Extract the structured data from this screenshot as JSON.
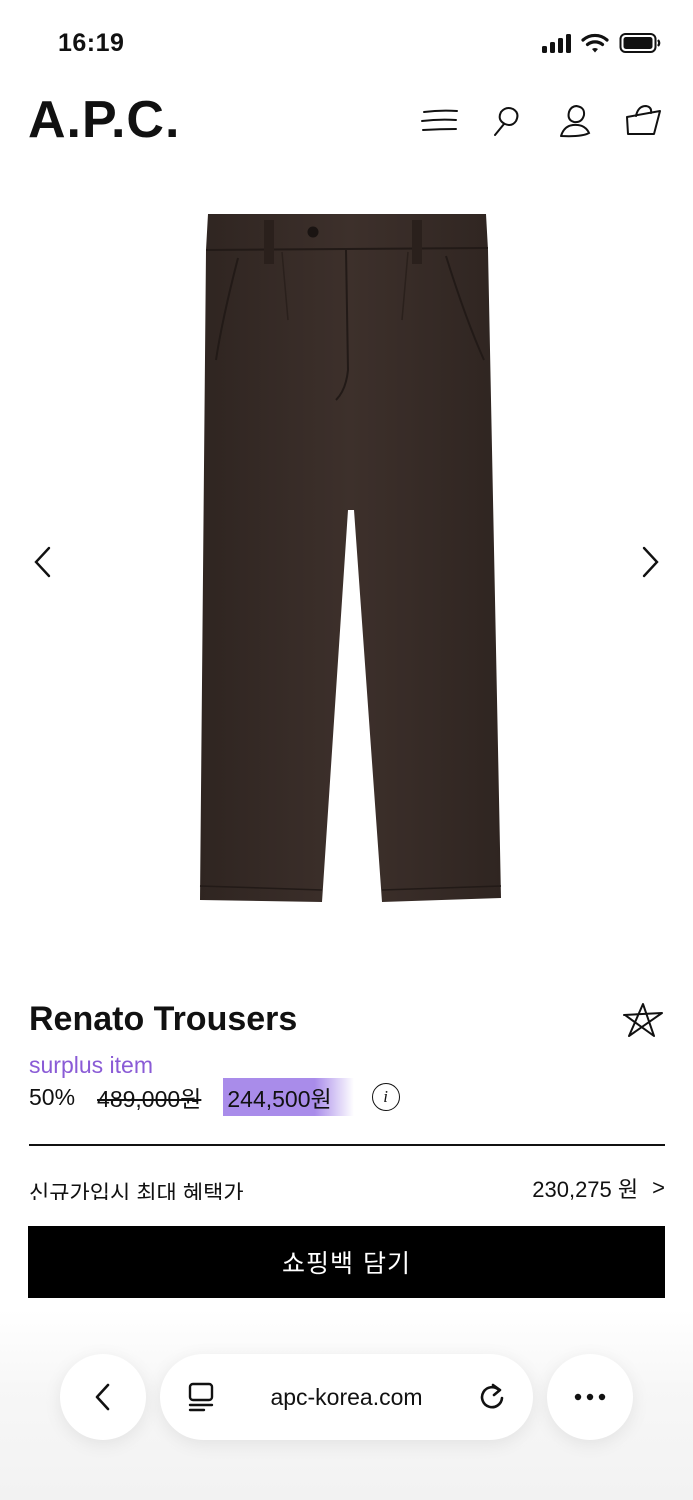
{
  "status": {
    "time": "16:19"
  },
  "header": {
    "logo": "A.P.C.",
    "icons": [
      "menu-icon",
      "search-icon",
      "account-icon",
      "bag-icon"
    ]
  },
  "gallery": {
    "image_alt": "Renato Trousers product image",
    "prev_icon": "chevron-left-icon",
    "next_icon": "chevron-right-icon"
  },
  "product": {
    "name": "Renato Trousers",
    "tag": "surplus item",
    "discount": "50%",
    "original_price": "489,000원",
    "sale_price": "244,500원",
    "info_glyph": "i",
    "wishlist_icon": "star-icon"
  },
  "benefit": {
    "label": "신규가입시 최대 혜택가",
    "value": "230,275 원",
    "arrow": ">"
  },
  "cart": {
    "label": "쇼핑백 담기"
  },
  "browser": {
    "url": "apc-korea.com",
    "back_icon": "chevron-left-icon",
    "reader_icon": "reader-icon",
    "reload_icon": "reload-icon",
    "more_icon": "more-icon"
  },
  "colors": {
    "accent_purple": "#8a5bd6",
    "highlight": "#a98cea",
    "pants": "#3b2e29",
    "button_bg": "#000000"
  }
}
